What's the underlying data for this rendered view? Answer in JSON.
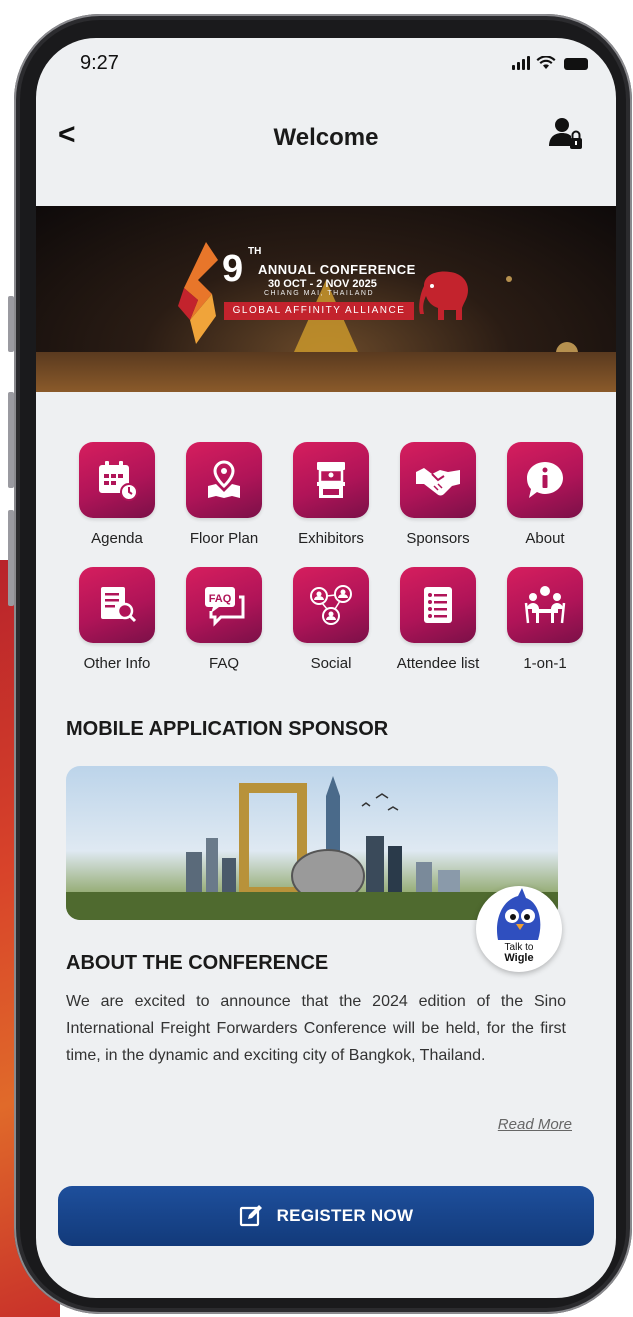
{
  "status_bar": {
    "time": "9:27"
  },
  "nav": {
    "back_label": "<",
    "title": "Welcome"
  },
  "banner": {
    "number": "9",
    "superscript": "TH",
    "title": "ANNUAL CONFERENCE",
    "dates": "30 OCT - 2 NOV 2025",
    "location": "CHIANG MAI, THAILAND",
    "ribbon": "GLOBAL AFFINITY ALLIANCE"
  },
  "grid": {
    "row1": [
      {
        "label": "Agenda",
        "icon": "calendar-icon"
      },
      {
        "label": "Floor Plan",
        "icon": "map-pin-icon"
      },
      {
        "label": "Exhibitors",
        "icon": "booth-icon"
      },
      {
        "label": "Sponsors",
        "icon": "handshake-icon"
      },
      {
        "label": "About",
        "icon": "info-icon"
      }
    ],
    "row2": [
      {
        "label": "Other Info",
        "icon": "document-search-icon"
      },
      {
        "label": "FAQ",
        "icon": "faq-icon"
      },
      {
        "label": "Social",
        "icon": "social-network-icon"
      },
      {
        "label": "Attendee list",
        "icon": "list-icon"
      },
      {
        "label": "1-on-1",
        "icon": "meeting-icon"
      }
    ]
  },
  "sponsor": {
    "heading": "MOBILE APPLICATION SPONSOR"
  },
  "about": {
    "heading": "ABOUT THE CONFERENCE",
    "body": "We are excited to announce that the 2024 edition of the Sino International Freight Forwarders Conference will be held, for the first time, in the dynamic and exciting city of Bangkok, Thailand.",
    "read_more": "Read More"
  },
  "chatbot": {
    "line1": "Talk to",
    "line2": "Wigle"
  },
  "register": {
    "label": "REGISTER NOW"
  },
  "colors": {
    "tile_accent": "#c41a5c",
    "register_blue": "#1a4690",
    "background": "#eef0f2"
  }
}
